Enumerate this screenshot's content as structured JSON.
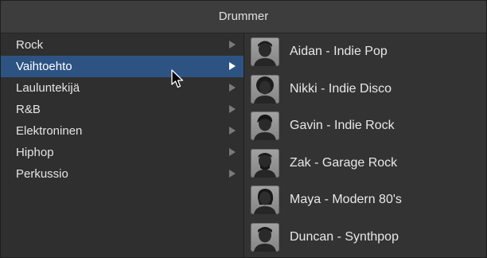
{
  "window": {
    "title": "Drummer"
  },
  "categories": [
    {
      "label": "Rock",
      "selected": false
    },
    {
      "label": "Vaihtoehto",
      "selected": true
    },
    {
      "label": "Lauluntekijä",
      "selected": false
    },
    {
      "label": "R&B",
      "selected": false
    },
    {
      "label": "Elektroninen",
      "selected": false
    },
    {
      "label": "Hiphop",
      "selected": false
    },
    {
      "label": "Perkussio",
      "selected": false
    }
  ],
  "drummers": [
    {
      "name": "Aidan - Indie Pop",
      "icon": "drummer-avatar-icon"
    },
    {
      "name": "Nikki - Indie Disco",
      "icon": "drummer-avatar-icon"
    },
    {
      "name": "Gavin - Indie Rock",
      "icon": "drummer-avatar-icon"
    },
    {
      "name": "Zak - Garage Rock",
      "icon": "drummer-avatar-icon"
    },
    {
      "name": "Maya - Modern 80's",
      "icon": "drummer-avatar-icon"
    },
    {
      "name": "Duncan - Synthpop",
      "icon": "drummer-avatar-icon"
    }
  ],
  "colors": {
    "selection": "#2d5383",
    "background": "#2f2f2f"
  }
}
